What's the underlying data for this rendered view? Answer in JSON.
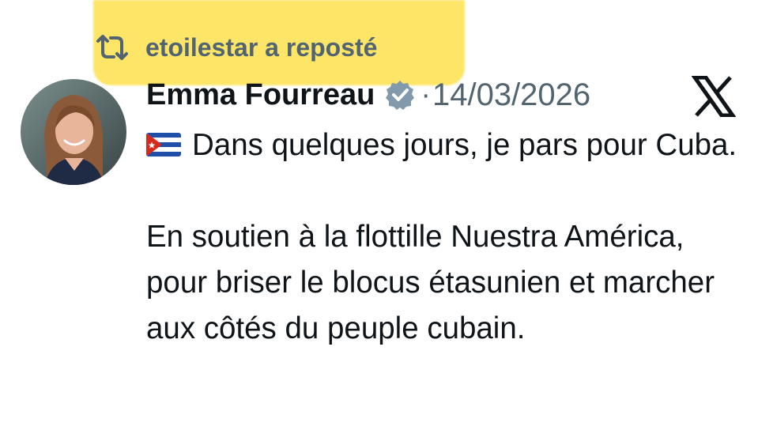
{
  "repost": {
    "label": "etoilestar a reposté",
    "icon": "repost-icon",
    "highlight_color": "#fde047"
  },
  "post": {
    "author_name": "Emma Fourreau",
    "verified_icon": "verified-badge-icon",
    "separator": "·",
    "date": "14/03/2026",
    "platform_icon": "x-logo-icon",
    "flag_icon": "cuba-flag-icon",
    "paragraphs": [
      "Dans quelques jours, je pars pour Cuba.",
      "En soutien à la flottille Nuestra América, pour briser le blocus étasunien et marcher aux côtés du peuple cubain."
    ]
  },
  "colors": {
    "text": "#0f1419",
    "muted": "#536471",
    "verified": "#829aab"
  }
}
